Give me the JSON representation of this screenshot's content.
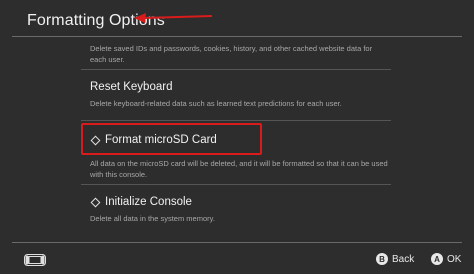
{
  "header": {
    "title": "Formatting Options"
  },
  "options": [
    {
      "label": "",
      "description": "Delete saved IDs and passwords, cookies, history, and other cached website data for each user."
    },
    {
      "label": "Reset Keyboard",
      "description": "Delete keyboard-related data such as learned text predictions for each user."
    },
    {
      "label": "Format microSD Card",
      "description": "All data on the microSD card will be deleted, and it will be formatted so that it can be used with this console."
    },
    {
      "label": "Initialize Console",
      "description": "Delete all data in the system memory."
    }
  ],
  "footer": {
    "back_label": "Back",
    "back_button_glyph": "B",
    "ok_label": "OK",
    "ok_button_glyph": "A"
  },
  "colors": {
    "background": "#2d2d2d",
    "highlight": "#d81b1b",
    "text": "#f2f2f2",
    "subtext": "#a8a8a8"
  },
  "icons": [
    "diamond-icon",
    "console-icon",
    "annotation-arrow"
  ]
}
